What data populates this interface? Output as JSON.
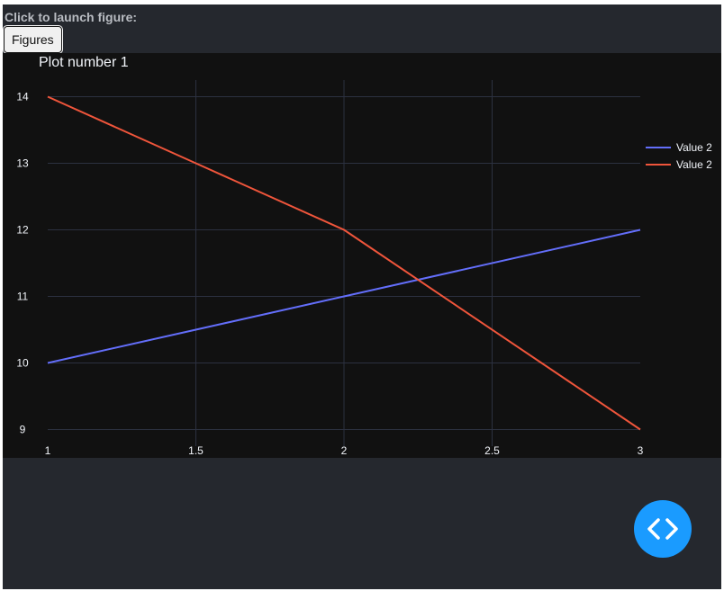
{
  "header": {
    "launch_label": "Click to launch figure:",
    "figures_button": "Figures"
  },
  "fab": {
    "icon": "code-icon"
  },
  "colors": {
    "background": "#25282e",
    "plot_bg": "#111111",
    "grid": "#2c3140",
    "fab": "#1a9bff",
    "series1": "#636efa",
    "series2": "#ef553b"
  },
  "chart_data": {
    "type": "line",
    "title": "Plot number 1",
    "xlabel": "",
    "ylabel": "",
    "xlim": [
      1,
      3
    ],
    "ylim": [
      8.75,
      14.25
    ],
    "xticks": [
      1,
      1.5,
      2,
      2.5,
      3
    ],
    "xtick_labels": [
      "1",
      "1.5",
      "2",
      "2.5",
      "3"
    ],
    "yticks": [
      9,
      10,
      11,
      12,
      13,
      14
    ],
    "ytick_labels": [
      "9",
      "10",
      "11",
      "12",
      "13",
      "14"
    ],
    "grid": true,
    "legend_position": "top-right",
    "series": [
      {
        "name": "Value 2",
        "x": [
          1,
          2,
          3
        ],
        "y": [
          10,
          11,
          12
        ],
        "color": "#636efa"
      },
      {
        "name": "Value 2",
        "x": [
          1,
          1.5,
          2,
          3
        ],
        "y": [
          14,
          13,
          12,
          9
        ],
        "color": "#ef553b"
      }
    ]
  }
}
